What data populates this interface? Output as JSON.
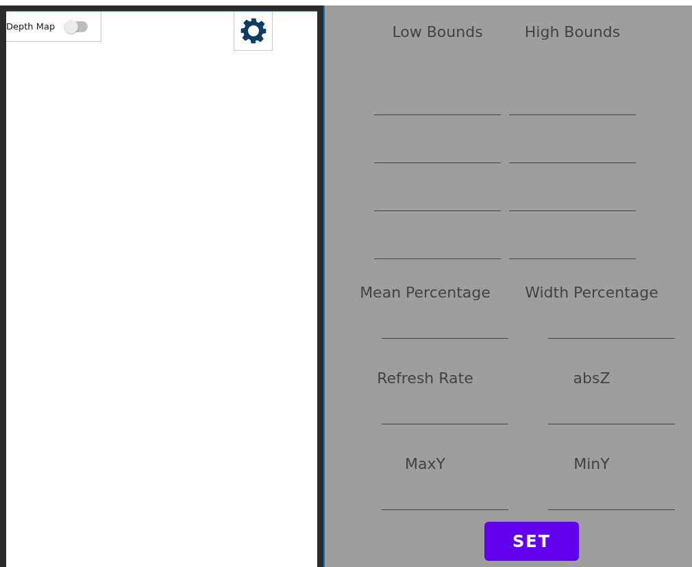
{
  "preview": {
    "toggle": {
      "label": "Depth Map",
      "on": false
    }
  },
  "bounds": {
    "headers": [
      "Low Bounds",
      "High Bounds"
    ],
    "rows": [
      {
        "fields": [
          {
            "kind": "input"
          },
          {
            "kind": "input"
          }
        ]
      },
      {
        "fields": [
          {
            "kind": "input"
          },
          {
            "kind": "input"
          }
        ]
      },
      {
        "fields": [
          {
            "kind": "input"
          },
          {
            "kind": "input"
          }
        ]
      },
      {
        "fields": [
          {
            "kind": "input"
          },
          {
            "kind": "input"
          }
        ]
      }
    ]
  },
  "params": [
    {
      "label": "Mean Percentage",
      "kind": "input"
    },
    {
      "label": "Width Percentage",
      "kind": "input"
    },
    {
      "label": "Refresh Rate",
      "kind": "input"
    },
    {
      "label": "absZ",
      "kind": "input"
    },
    {
      "label": "MaxY",
      "kind": "input"
    },
    {
      "label": "MinY",
      "kind": "input"
    }
  ],
  "button": "SET"
}
